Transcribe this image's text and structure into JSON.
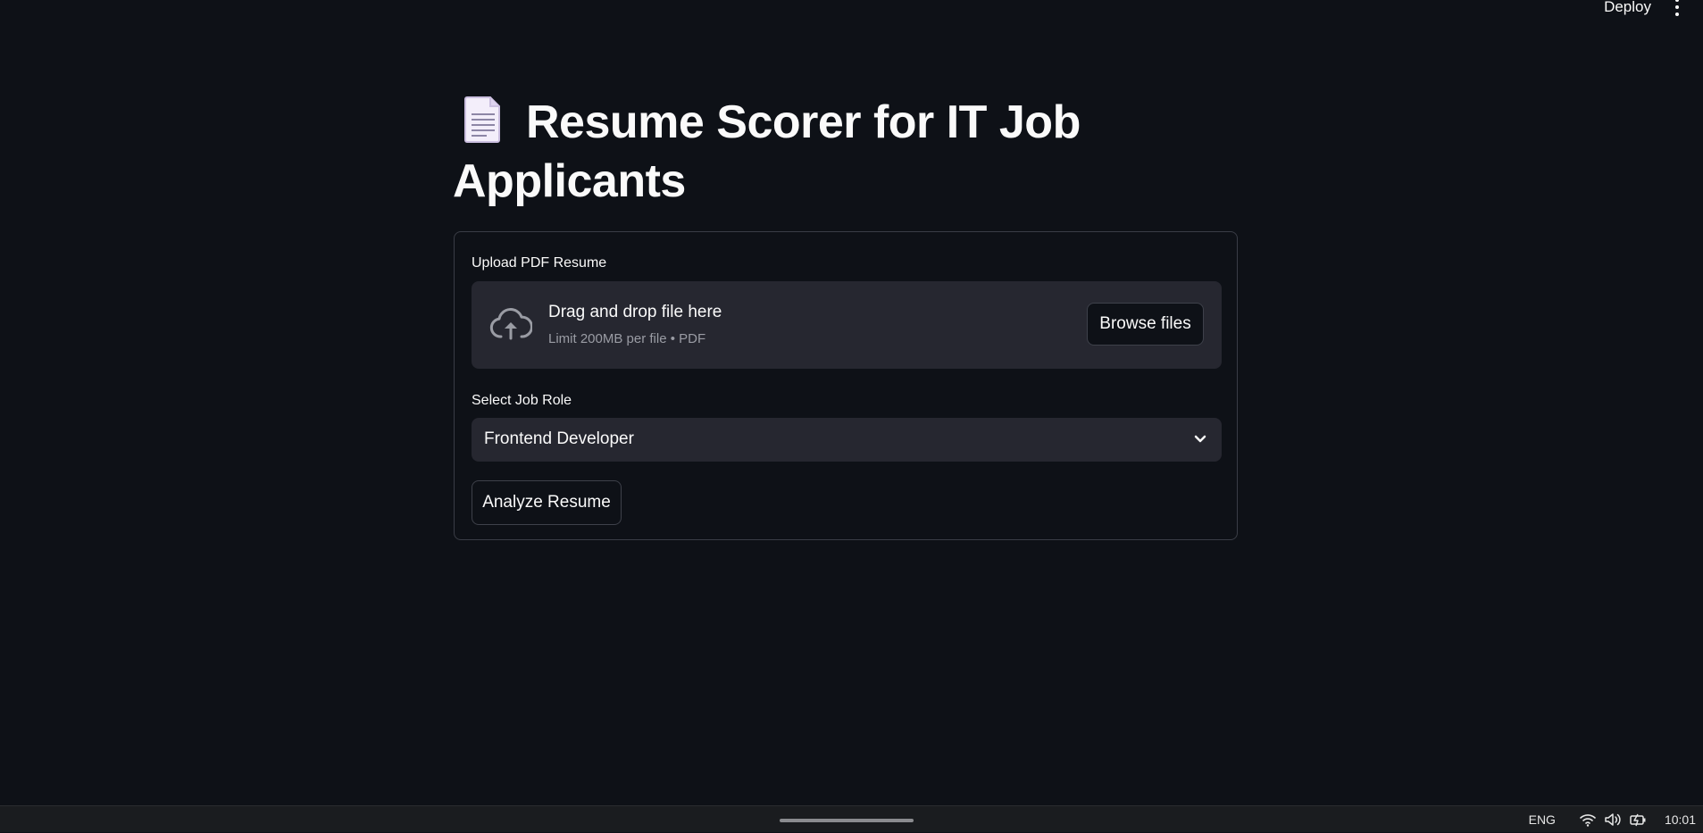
{
  "header": {
    "deploy_label": "Deploy",
    "menu_icon": "kebab-menu-icon"
  },
  "page": {
    "title_icon": "page-document-icon",
    "title_line1": "Resume Scorer for IT Job",
    "title_line2": "Applicants"
  },
  "upload": {
    "label": "Upload PDF Resume",
    "icon": "cloud-upload-icon",
    "drop_title": "Drag and drop file here",
    "drop_subtitle": "Limit 200MB per file • PDF",
    "browse_label": "Browse files"
  },
  "job_role": {
    "label": "Select Job Role",
    "selected": "Frontend Developer",
    "icon": "chevron-down-icon"
  },
  "actions": {
    "analyze_label": "Analyze Resume"
  },
  "taskbar": {
    "language": "ENG",
    "time": "10:01",
    "icons": [
      "wifi-icon",
      "volume-icon",
      "battery-icon"
    ]
  },
  "colors": {
    "background": "#0e1117",
    "surface": "#262730",
    "border": "#3a3d46",
    "text": "#fafafa",
    "muted_text": "#9a9ca4"
  }
}
